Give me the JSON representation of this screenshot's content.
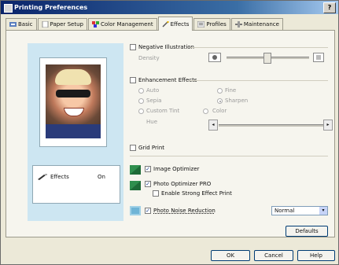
{
  "window": {
    "title": "Printing Preferences",
    "help_label": "?"
  },
  "tabs": [
    {
      "label": "Basic"
    },
    {
      "label": "Paper Setup"
    },
    {
      "label": "Color Management"
    },
    {
      "label": "Effects"
    },
    {
      "label": "Profiles"
    },
    {
      "label": "Maintenance"
    }
  ],
  "preview": {
    "summary": {
      "effect_name": "Effects",
      "effect_value": "On"
    }
  },
  "options": {
    "negative_illustration": {
      "label": "Negative Illustration",
      "checked": false,
      "sub_label": "Density",
      "slider_value": 0.48
    },
    "enhancement": {
      "label": "Enhancement Effects",
      "checked": false,
      "radios": [
        {
          "label": "Auto"
        },
        {
          "label": "Fine"
        },
        {
          "label": "Sepia"
        },
        {
          "label": "Sharpen"
        },
        {
          "label": "Custom Tint"
        },
        {
          "label": "Color"
        }
      ],
      "hue_label": "Hue"
    },
    "grid_print": {
      "label": "Grid Print",
      "checked": false
    },
    "image_optimizer": {
      "label": "Image Optimizer",
      "checked": true
    },
    "photo_optimizer": {
      "label": "Photo Optimizer PRO",
      "checked": true
    },
    "enable_strong_effect": {
      "label": "Enable Strong Effect Print",
      "checked": false
    },
    "photo_noise_reduction": {
      "label": "Photo Noise Reduction",
      "checked": true,
      "dropdown_value": "Normal"
    }
  },
  "buttons": {
    "defaults": "Defaults",
    "ok": "OK",
    "cancel": "Cancel",
    "help": "Help"
  },
  "colors": {
    "accent_green": "#2f8f4e",
    "preview_bg": "#cde6f2",
    "title_bar": "#0a246a"
  }
}
